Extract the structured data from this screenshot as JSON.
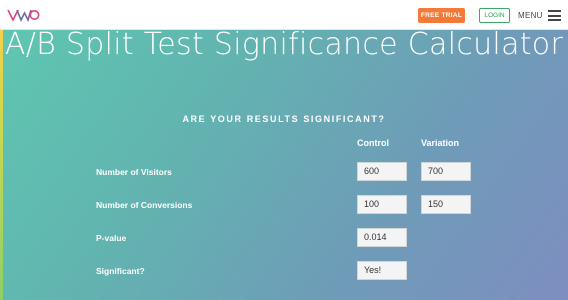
{
  "header": {
    "free_trial_label": "FREE TRIAL",
    "login_label": "LOGIN",
    "menu_label": "MENU",
    "brand_colors": {
      "accent": "#f47a3a",
      "login_green": "#3aa868",
      "logo_pink": "#e0427e"
    }
  },
  "page": {
    "title": "A/B Split Test Significance Calculator",
    "section_heading": "ARE YOUR RESULTS SIGNIFICANT?"
  },
  "calculator": {
    "columns": [
      "Control",
      "Variation"
    ],
    "rows": [
      {
        "label": "Number of Visitors",
        "control": "600",
        "variation": "700"
      },
      {
        "label": "Number of Conversions",
        "control": "100",
        "variation": "150"
      },
      {
        "label": "P-value",
        "control": "0.014"
      },
      {
        "label": "Significant?",
        "control": "Yes!"
      }
    ]
  }
}
